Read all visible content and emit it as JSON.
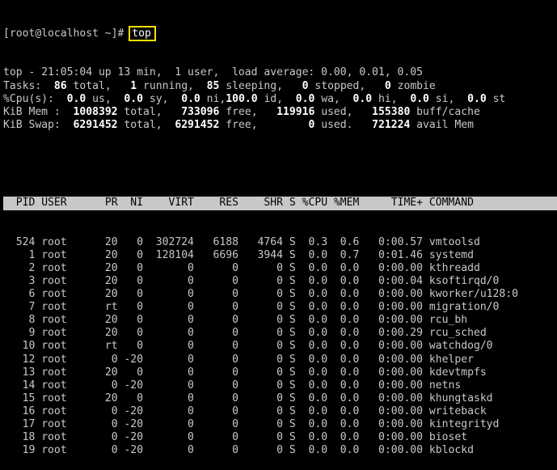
{
  "prompt": {
    "text": "[root@localhost ~]# ",
    "command": "top"
  },
  "summary": [
    [
      {
        "t": "top - 21:05:04 up 13 min,  1 user,  load average: 0.00, 0.01, 0.05"
      }
    ],
    [
      {
        "t": "Tasks: "
      },
      {
        "t": " 86",
        "b": 1
      },
      {
        "t": " total,   "
      },
      {
        "t": "1",
        "b": 1
      },
      {
        "t": " running,  "
      },
      {
        "t": "85",
        "b": 1
      },
      {
        "t": " sleeping,   "
      },
      {
        "t": "0",
        "b": 1
      },
      {
        "t": " stopped,   "
      },
      {
        "t": "0",
        "b": 1
      },
      {
        "t": " zombie"
      }
    ],
    [
      {
        "t": "%Cpu(s):  "
      },
      {
        "t": "0.0",
        "b": 1
      },
      {
        "t": " us,  "
      },
      {
        "t": "0.0",
        "b": 1
      },
      {
        "t": " sy,  "
      },
      {
        "t": "0.0",
        "b": 1
      },
      {
        "t": " ni,"
      },
      {
        "t": "100.0",
        "b": 1
      },
      {
        "t": " id,  "
      },
      {
        "t": "0.0",
        "b": 1
      },
      {
        "t": " wa,  "
      },
      {
        "t": "0.0",
        "b": 1
      },
      {
        "t": " hi,  "
      },
      {
        "t": "0.0",
        "b": 1
      },
      {
        "t": " si,  "
      },
      {
        "t": "0.0",
        "b": 1
      },
      {
        "t": " st"
      }
    ],
    [
      {
        "t": "KiB Mem :  "
      },
      {
        "t": "1008392",
        "b": 1
      },
      {
        "t": " total,   "
      },
      {
        "t": "733096",
        "b": 1
      },
      {
        "t": " free,   "
      },
      {
        "t": "119916",
        "b": 1
      },
      {
        "t": " used,   "
      },
      {
        "t": "155380",
        "b": 1
      },
      {
        "t": " buff/cache"
      }
    ],
    [
      {
        "t": "KiB Swap:  "
      },
      {
        "t": "6291452",
        "b": 1
      },
      {
        "t": " total,  "
      },
      {
        "t": "6291452",
        "b": 1
      },
      {
        "t": " free,        "
      },
      {
        "t": "0",
        "b": 1
      },
      {
        "t": " used.   "
      },
      {
        "t": "721224",
        "b": 1
      },
      {
        "t": " avail Mem"
      }
    ]
  ],
  "table": {
    "header": [
      "PID",
      "USER",
      "PR",
      "NI",
      "VIRT",
      "RES",
      "SHR",
      "S",
      "%CPU",
      "%MEM",
      "TIME+",
      "COMMAND"
    ],
    "rows": [
      [
        "524",
        "root",
        "20",
        "0",
        "302724",
        "6188",
        "4764",
        "S",
        "0.3",
        "0.6",
        "0:00.57",
        "vmtoolsd"
      ],
      [
        "1",
        "root",
        "20",
        "0",
        "128104",
        "6696",
        "3944",
        "S",
        "0.0",
        "0.7",
        "0:01.46",
        "systemd"
      ],
      [
        "2",
        "root",
        "20",
        "0",
        "0",
        "0",
        "0",
        "S",
        "0.0",
        "0.0",
        "0:00.00",
        "kthreadd"
      ],
      [
        "3",
        "root",
        "20",
        "0",
        "0",
        "0",
        "0",
        "S",
        "0.0",
        "0.0",
        "0:00.04",
        "ksoftirqd/0"
      ],
      [
        "6",
        "root",
        "20",
        "0",
        "0",
        "0",
        "0",
        "S",
        "0.0",
        "0.0",
        "0:00.00",
        "kworker/u128:0"
      ],
      [
        "7",
        "root",
        "rt",
        "0",
        "0",
        "0",
        "0",
        "S",
        "0.0",
        "0.0",
        "0:00.00",
        "migration/0"
      ],
      [
        "8",
        "root",
        "20",
        "0",
        "0",
        "0",
        "0",
        "S",
        "0.0",
        "0.0",
        "0:00.00",
        "rcu_bh"
      ],
      [
        "9",
        "root",
        "20",
        "0",
        "0",
        "0",
        "0",
        "S",
        "0.0",
        "0.0",
        "0:00.29",
        "rcu_sched"
      ],
      [
        "10",
        "root",
        "rt",
        "0",
        "0",
        "0",
        "0",
        "S",
        "0.0",
        "0.0",
        "0:00.00",
        "watchdog/0"
      ],
      [
        "12",
        "root",
        "0",
        "-20",
        "0",
        "0",
        "0",
        "S",
        "0.0",
        "0.0",
        "0:00.00",
        "khelper"
      ],
      [
        "13",
        "root",
        "20",
        "0",
        "0",
        "0",
        "0",
        "S",
        "0.0",
        "0.0",
        "0:00.00",
        "kdevtmpfs"
      ],
      [
        "14",
        "root",
        "0",
        "-20",
        "0",
        "0",
        "0",
        "S",
        "0.0",
        "0.0",
        "0:00.00",
        "netns"
      ],
      [
        "15",
        "root",
        "20",
        "0",
        "0",
        "0",
        "0",
        "S",
        "0.0",
        "0.0",
        "0:00.00",
        "khungtaskd"
      ],
      [
        "16",
        "root",
        "0",
        "-20",
        "0",
        "0",
        "0",
        "S",
        "0.0",
        "0.0",
        "0:00.00",
        "writeback"
      ],
      [
        "17",
        "root",
        "0",
        "-20",
        "0",
        "0",
        "0",
        "S",
        "0.0",
        "0.0",
        "0:00.00",
        "kintegrityd"
      ],
      [
        "18",
        "root",
        "0",
        "-20",
        "0",
        "0",
        "0",
        "S",
        "0.0",
        "0.0",
        "0:00.00",
        "bioset"
      ],
      [
        "19",
        "root",
        "0",
        "-20",
        "0",
        "0",
        "0",
        "S",
        "0.0",
        "0.0",
        "0:00.00",
        "kblockd"
      ]
    ]
  }
}
